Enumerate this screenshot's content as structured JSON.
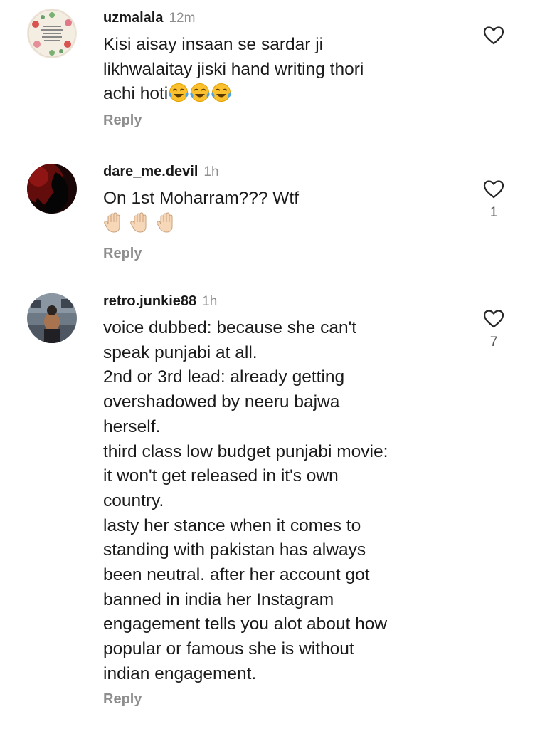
{
  "comments": [
    {
      "username": "uzmalala",
      "time": "12m",
      "lines": [
        "Kisi aisay insaan se sardar ji",
        "likhwalaitay jiski hand writing thori",
        "achi hoti"
      ],
      "trailing_emojis": [
        "laughing-tears-emoji",
        "laughing-tears-emoji",
        "laughing-tears-emoji"
      ],
      "reply_label": "Reply",
      "likes": ""
    },
    {
      "username": "dare_me.devil",
      "time": "1h",
      "lines": [
        "On 1st Moharram??? Wtf"
      ],
      "emoji_line": [
        "raised-hand-emoji",
        "raised-hand-emoji",
        "raised-hand-emoji"
      ],
      "reply_label": "Reply",
      "likes": "1"
    },
    {
      "username": "retro.junkie88",
      "time": "1h",
      "lines": [
        "voice dubbed: because she can't",
        "speak punjabi at all.",
        "2nd or 3rd lead: already getting",
        "overshadowed by neeru bajwa",
        "herself.",
        "third class low budget punjabi movie:",
        "it won't get released in it's own",
        "country.",
        "lasty her stance when it comes to",
        "standing with pakistan has always",
        "been neutral. after her account got",
        "banned in india her Instagram",
        "engagement tells you alot about how",
        "popular or famous she is without",
        "indian engagement."
      ],
      "reply_label": "Reply",
      "likes": "7"
    }
  ],
  "colors": {
    "text": "#1a1a1a",
    "muted": "#8e8e8e",
    "background": "#ffffff"
  }
}
